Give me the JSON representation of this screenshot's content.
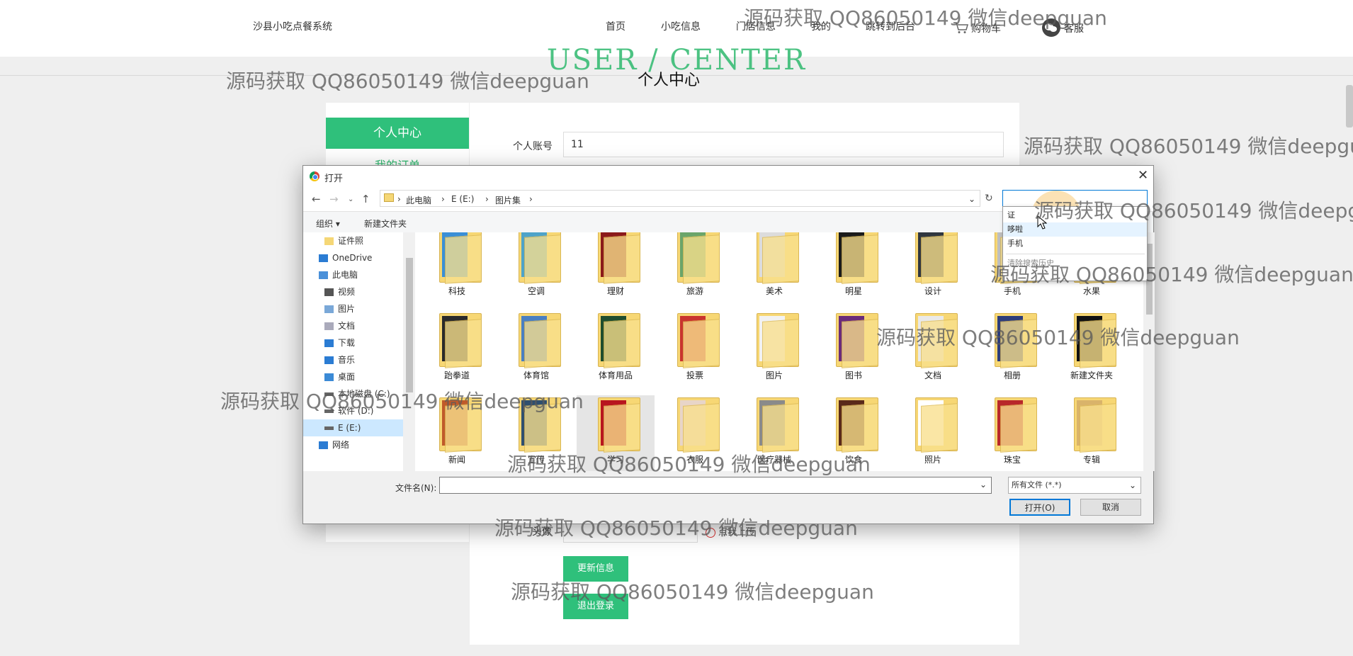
{
  "site": {
    "brand": "沙县小吃点餐系统",
    "nav": [
      "首页",
      "小吃信息",
      "门店信息",
      "我的",
      "跳转到后台",
      "购物车",
      "客服"
    ],
    "section_banner": "USER / CENTER",
    "page_title": "个人中心"
  },
  "sidebar": {
    "active": "个人中心",
    "orders": "我的订单"
  },
  "form": {
    "account_label": "个人账号",
    "account_value": "11",
    "avatar_label": "头像",
    "gender_option": "点我上传",
    "update_button": "更新信息",
    "logout_button": "退出登录"
  },
  "dialog": {
    "title": "打开",
    "breadcrumb": [
      "此电脑",
      "E (E:)",
      "图片集"
    ],
    "toolbar": {
      "organize": "组织 ▾",
      "new_folder": "新建文件夹"
    },
    "nav_pane": [
      {
        "label": "证件照",
        "icon": "folder-icon"
      },
      {
        "label": "OneDrive",
        "icon": "cloud-icon"
      },
      {
        "label": "此电脑",
        "icon": "computer-icon"
      },
      {
        "label": "视频",
        "icon": "video-icon"
      },
      {
        "label": "图片",
        "icon": "image-icon"
      },
      {
        "label": "文档",
        "icon": "document-icon"
      },
      {
        "label": "下载",
        "icon": "download-icon"
      },
      {
        "label": "音乐",
        "icon": "music-icon"
      },
      {
        "label": "桌面",
        "icon": "desktop-icon"
      },
      {
        "label": "本地磁盘 (C:)",
        "icon": "drive-icon"
      },
      {
        "label": "软件 (D:)",
        "icon": "drive-icon"
      },
      {
        "label": "E (E:)",
        "icon": "drive-icon"
      },
      {
        "label": "网络",
        "icon": "network-icon"
      }
    ],
    "folders": [
      "科技",
      "空调",
      "理财",
      "旅游",
      "美术",
      "明星",
      "设计",
      "手机",
      "水果",
      "跆拳道",
      "体育馆",
      "体育用品",
      "投票",
      "图片",
      "图书",
      "文档",
      "相册",
      "新建文件夹",
      "新闻",
      "宣传",
      "学习",
      "衣服",
      "医疗器械",
      "饮食",
      "照片",
      "珠宝",
      "专辑"
    ],
    "folder_colors": [
      "#3a8fd6",
      "#4ea3c9",
      "#8b1a1a",
      "#6aa56a",
      "#dcdcdc",
      "#1b1b1b",
      "#30373f",
      "#bfbfbf",
      "#d8a33a",
      "#2a2a2a",
      "#4a7fc1",
      "#1f4d2e",
      "#c9342e",
      "#f2f2f2",
      "#6a2b7a",
      "#e9e9e9",
      "#2d3d7a",
      "#111111",
      "#c05a2a",
      "#2f4f6f",
      "#b8161f",
      "#e8d5c8",
      "#8a8a8a",
      "#5a2a1a",
      "#ffffff",
      "#b8282a",
      "#d9b36a"
    ],
    "search_suggestions": [
      "证",
      "哆啦",
      "手机"
    ],
    "search_clear": "清除搜索历史",
    "filename_label": "文件名(N):",
    "filetype": "所有文件 (*.*)",
    "open_button": "打开(O)",
    "cancel_button": "取消"
  },
  "watermark": "源码获取 QQ86050149 微信deepguan"
}
